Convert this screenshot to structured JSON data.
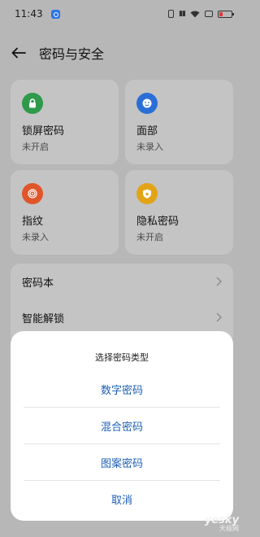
{
  "status_bar": {
    "time": "11:43",
    "icons": [
      "app-notification-icon",
      "vibrate-icon",
      "signal-icon",
      "wifi-icon",
      "camera-icon",
      "battery-low-icon"
    ]
  },
  "header": {
    "title": "密码与安全",
    "back_icon": "back-arrow-icon"
  },
  "cards": [
    {
      "title": "锁屏密码",
      "status": "未开启",
      "icon": "lock-icon",
      "color": "#2e9a4a"
    },
    {
      "title": "面部",
      "status": "未录入",
      "icon": "face-icon",
      "color": "#2a6fd6"
    },
    {
      "title": "指纹",
      "status": "未录入",
      "icon": "fingerprint-icon",
      "color": "#e0562a"
    },
    {
      "title": "隐私密码",
      "status": "未开启",
      "icon": "shield-icon",
      "color": "#e2a417"
    }
  ],
  "list": {
    "items": [
      {
        "label": "密码本"
      },
      {
        "label": "智能解锁"
      }
    ]
  },
  "sheet": {
    "title": "选择密码类型",
    "options": [
      "数字密码",
      "混合密码",
      "图案密码",
      "取消"
    ]
  },
  "colors": {
    "accent_text": "#1e5fb5",
    "dim_background": "#b7b7b7"
  },
  "watermark": {
    "main": "yesky",
    "sub": "天极网"
  }
}
